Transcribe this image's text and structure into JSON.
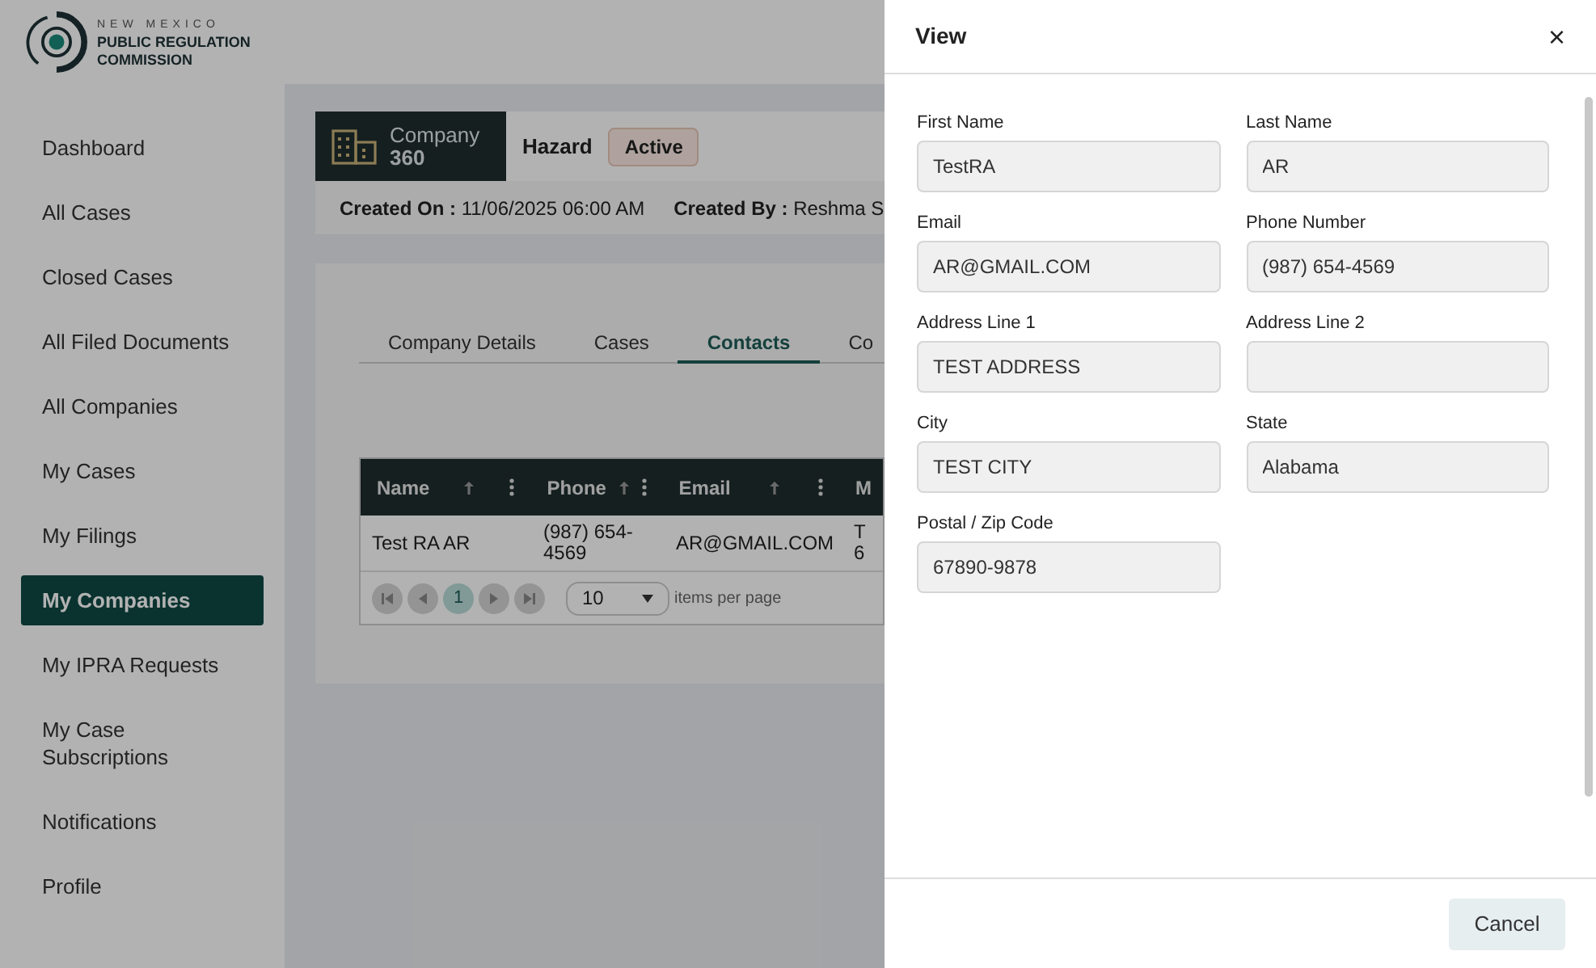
{
  "logo": {
    "line_1": "NEW MEXICO",
    "line_2": "PUBLIC REGULATION",
    "line_3": "COMMISSION"
  },
  "sidebar": {
    "items": [
      {
        "label": "Dashboard",
        "selected": false
      },
      {
        "label": "All Cases",
        "selected": false
      },
      {
        "label": "Closed Cases",
        "selected": false
      },
      {
        "label": "All Filed Documents",
        "selected": false
      },
      {
        "label": "All Companies",
        "selected": false
      },
      {
        "label": "My Cases",
        "selected": false
      },
      {
        "label": "My Filings",
        "selected": false
      },
      {
        "label": "My Companies",
        "selected": true
      },
      {
        "label": "My IPRA Requests",
        "selected": false
      },
      {
        "label": "My Case Subscriptions",
        "selected": false
      },
      {
        "label": "Notifications",
        "selected": false
      },
      {
        "label": "Profile",
        "selected": false
      }
    ]
  },
  "company": {
    "title": "Company",
    "subtitle": "360",
    "name": "Hazard",
    "status": "Active",
    "created_on_label": "Created On :",
    "created_on": "11/06/2025 06:00 AM",
    "created_by_label": "Created By :",
    "created_by": "Reshma S"
  },
  "tabs": [
    {
      "label": "Company Details",
      "selected": false
    },
    {
      "label": "Cases",
      "selected": false
    },
    {
      "label": "Contacts",
      "selected": true
    },
    {
      "label": "Co",
      "selected": false
    }
  ],
  "table": {
    "columns": [
      "Name",
      "Phone",
      "Email",
      "M"
    ],
    "rows": [
      [
        "Test RA AR",
        "(987) 654-4569",
        "AR@GMAIL.COM",
        "T 6"
      ]
    ]
  },
  "pager": {
    "page": "1",
    "page_size": "10",
    "page_size_label": "items per page"
  },
  "drawer": {
    "title": "View",
    "close": "×",
    "fields": [
      {
        "label": "First Name",
        "value": "TestRA"
      },
      {
        "label": "Last Name",
        "value": "AR"
      },
      {
        "label": "Email",
        "value": "AR@GMAIL.COM"
      },
      {
        "label": "Phone Number",
        "value": "(987) 654-4569"
      },
      {
        "label": "Address Line 1",
        "value": "TEST ADDRESS"
      },
      {
        "label": "Address Line 2"
      },
      {
        "label": "City",
        "value": "TEST CITY"
      },
      {
        "label": "State",
        "value": "Alabama"
      },
      {
        "label": "Postal / Zip Code",
        "value": "67890-9878"
      }
    ],
    "cancel": "Cancel"
  }
}
